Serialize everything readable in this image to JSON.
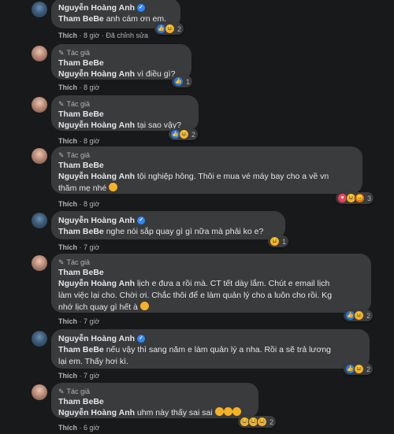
{
  "comments": [
    {
      "author": "Nguyễn Hoàng Anh",
      "verified": true,
      "mention": "Tham BeBe",
      "text": "anh cám ơn em.",
      "like": "Thích",
      "time": "8 giờ",
      "edited": "Đã chỉnh sửa",
      "reactions": [
        "like",
        "haha"
      ],
      "count": "2"
    },
    {
      "tag": "Tác giả",
      "author": "Tham BeBe",
      "mention": "Nguyễn Hoàng Anh",
      "text": "vì điều gì?",
      "like": "Thích",
      "time": "8 giờ",
      "reactions": [
        "like"
      ],
      "count": "1"
    },
    {
      "tag": "Tác giả",
      "author": "Tham BeBe",
      "mention": "Nguyễn Hoàng Anh",
      "text": "tại sao vậy?",
      "like": "Thích",
      "time": "8 giờ",
      "reactions": [
        "like",
        "haha"
      ],
      "count": "2"
    },
    {
      "tag": "Tác giả",
      "author": "Tham BeBe",
      "mention": "Nguyễn Hoàng Anh",
      "text_line1": "tội nghiệp hông. Thôi e mua vé máy bay cho a về vn",
      "text_line2": "thăm mẹ nhé",
      "like": "Thích",
      "time": "8 giờ",
      "reactions": [
        "love",
        "haha",
        "angry"
      ],
      "count": "3"
    },
    {
      "author": "Nguyễn Hoàng Anh",
      "verified": true,
      "mention": "Tham BeBe",
      "text": "nghe nói sắp quay gì gì nữa mà phải ko e?",
      "like": "Thích",
      "time": "7 giờ",
      "reactions": [
        "haha"
      ],
      "count": "1"
    },
    {
      "tag": "Tác giả",
      "author": "Tham BeBe",
      "mention": "Nguyễn Hoàng Anh",
      "text_line1": "lịch e đưa a rồi mà. CT tết dày lắm. Chút e email lịch",
      "text_line2": "làm việc lại cho. Chời ơi. Chắc thôi để e làm quản lý cho a luôn cho rồi. Kg",
      "text_line3": "nhớ lịch quay gì hết à",
      "like": "Thích",
      "time": "7 giờ",
      "reactions": [
        "like",
        "haha"
      ],
      "count": "2"
    },
    {
      "author": "Nguyễn Hoàng Anh",
      "verified": true,
      "mention": "Tham BeBe",
      "text_line1": "nếu vậy thì sang năm e làm quản lý a nha. Rồi a sẽ trả lương",
      "text_line2": "lại em. Thấy hơi kì.",
      "like": "Thích",
      "time": "7 giờ",
      "reactions": [
        "like",
        "haha"
      ],
      "count": "2"
    },
    {
      "tag": "Tác giả",
      "author": "Tham BeBe",
      "mention": "Nguyễn Hoàng Anh",
      "text": "uhm này thấy sai sai",
      "like": "Thích",
      "time": "6 giờ",
      "reactions": [
        "laugh",
        "laugh",
        "laugh"
      ],
      "count": "2"
    }
  ]
}
